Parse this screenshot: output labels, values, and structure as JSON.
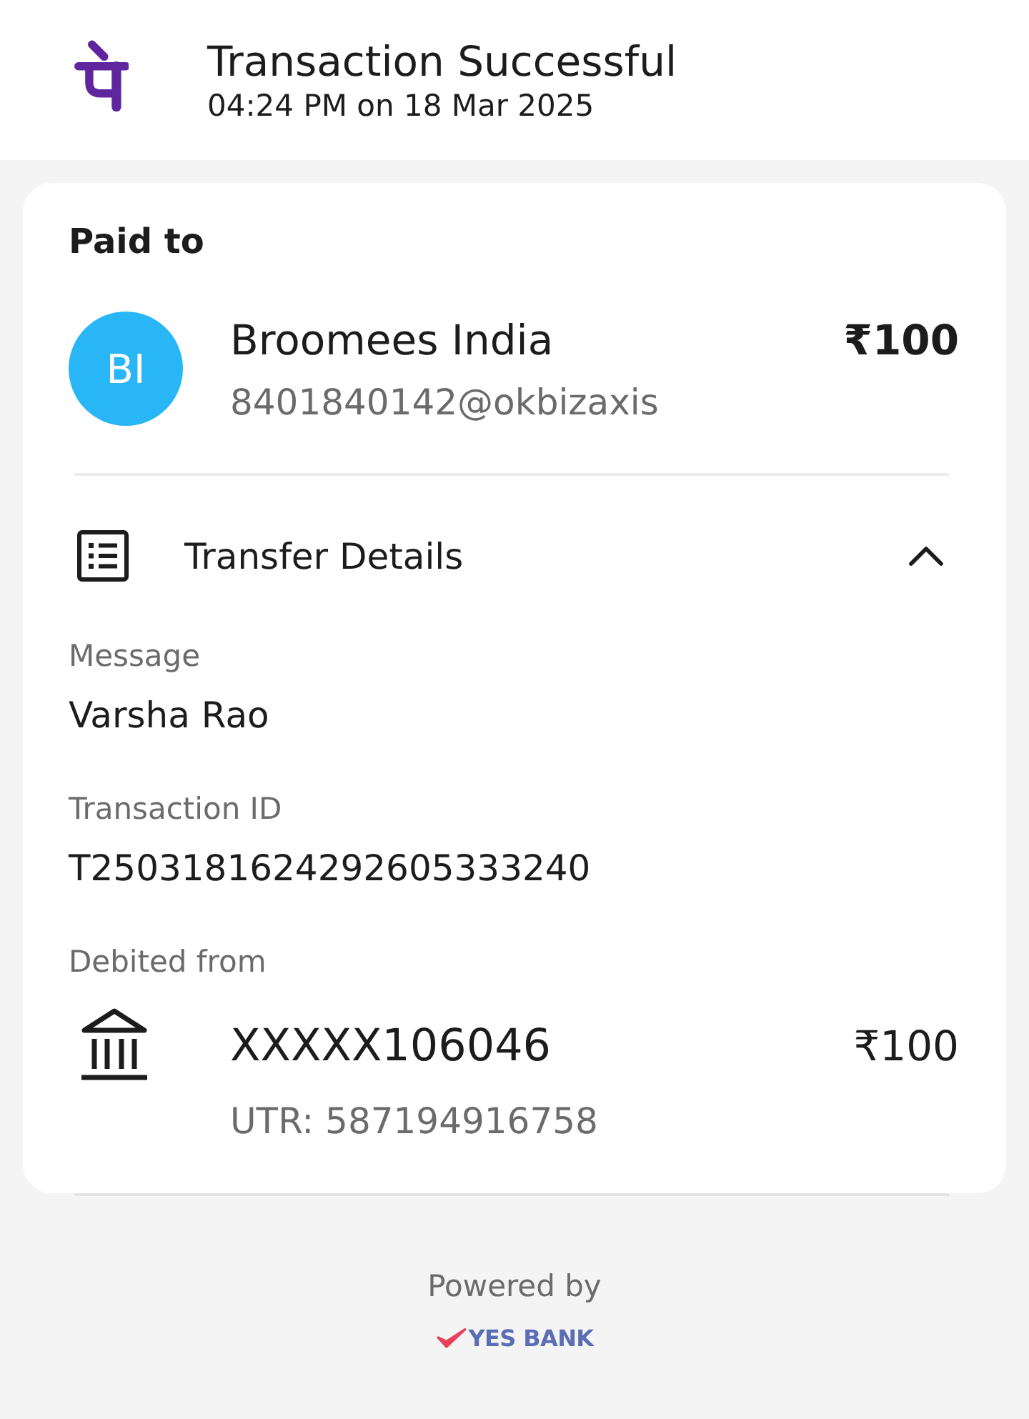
{
  "header": {
    "title": "Transaction Successful",
    "timestamp": "04:24 PM on 18 Mar 2025"
  },
  "paid_to": {
    "heading": "Paid to",
    "avatar_initials": "BI",
    "name": "Broomees India",
    "upi_id": "8401840142@okbizaxis",
    "amount": "₹100"
  },
  "transfer_details": {
    "title": "Transfer Details",
    "expanded": true,
    "fields": [
      {
        "label": "Message",
        "value": "Varsha Rao"
      },
      {
        "label": "Transaction ID",
        "value": "T2503181624292605333240"
      }
    ],
    "debited_from": {
      "label": "Debited from",
      "account": "XXXXX106046",
      "utr": "UTR: 587194916758",
      "amount": "₹100"
    }
  },
  "footer": {
    "powered_by": "Powered by",
    "bank": "YES BANK"
  }
}
